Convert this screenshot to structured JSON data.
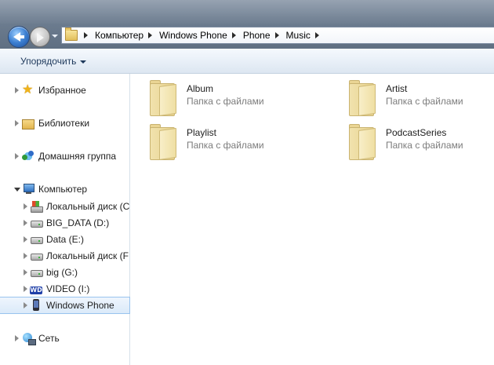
{
  "address": {
    "crumbs": [
      "Компьютер",
      "Windows Phone",
      "Phone",
      "Music"
    ]
  },
  "toolbar": {
    "organize_label": "Упорядочить"
  },
  "nav": {
    "favorites": "Избранное",
    "libraries": "Библиотеки",
    "homegroup": "Домашняя группа",
    "computer": "Компьютер",
    "drives": [
      {
        "label": "Локальный диск (C",
        "icon": "disk-windows-icon"
      },
      {
        "label": "BIG_DATA (D:)",
        "icon": "disk-icon"
      },
      {
        "label": "Data (E:)",
        "icon": "disk-icon"
      },
      {
        "label": "Локальный диск (F",
        "icon": "disk-icon"
      },
      {
        "label": "big (G:)",
        "icon": "disk-icon"
      },
      {
        "label": "VIDEO (I:)",
        "icon": "wd-drive-icon",
        "icon_text": "WD"
      },
      {
        "label": "Windows Phone",
        "icon": "phone-icon",
        "selected": true
      }
    ],
    "network": "Сеть"
  },
  "folders": [
    {
      "name": "Album",
      "subtitle": "Папка с файлами"
    },
    {
      "name": "Artist",
      "subtitle": "Папка с файлами"
    },
    {
      "name": "Playlist",
      "subtitle": "Папка с файлами"
    },
    {
      "name": "PodcastSeries",
      "subtitle": "Папка с файлами"
    }
  ]
}
